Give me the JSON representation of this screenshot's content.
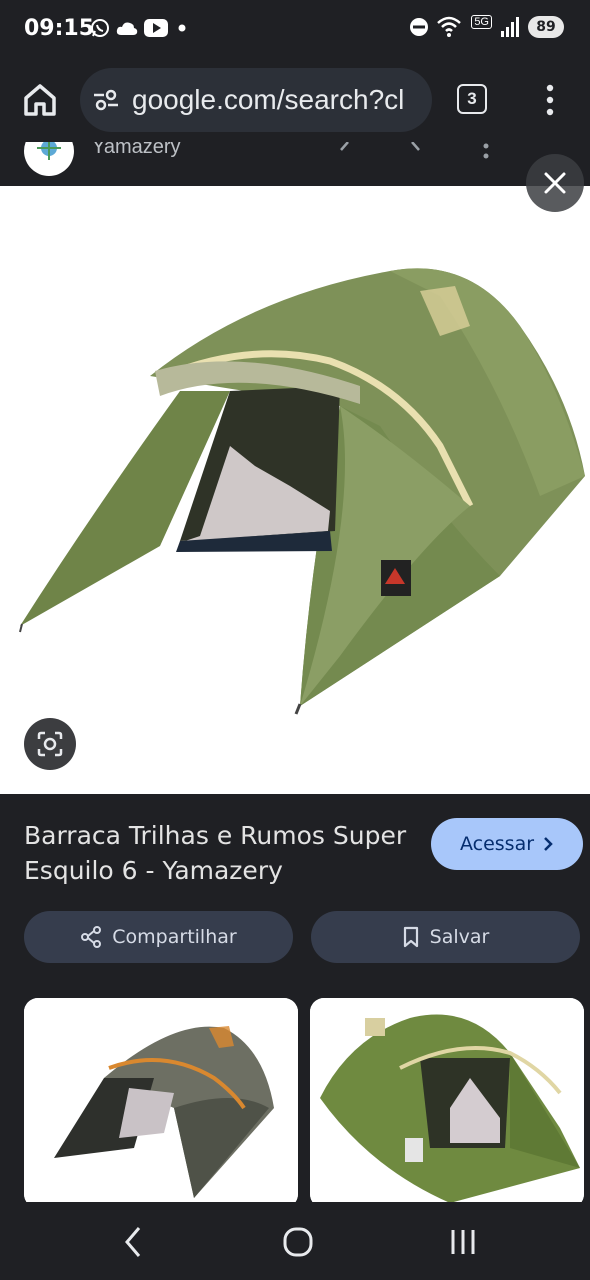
{
  "status_bar": {
    "time": "09:15",
    "left_icons": [
      "whatsapp-icon",
      "cloud-icon",
      "youtube-icon",
      "dot-icon"
    ],
    "right_icons": [
      "do-not-disturb-icon",
      "wifi-icon",
      "5g-icon",
      "signal-icon"
    ],
    "network_label": "5G",
    "battery": "89"
  },
  "browser": {
    "url": "google.com/search?cl",
    "tab_count": "3"
  },
  "source": {
    "name": "Yamazery"
  },
  "result": {
    "title": "Barraca Trilhas e Rumos Super Esquilo 6 - Yamazery",
    "visit_label": "Acessar",
    "share_label": "Compartilhar",
    "save_label": "Salvar"
  },
  "colors": {
    "background": "#1f2024",
    "accent_button": "#a8c7fa",
    "secondary_button": "#363d4d",
    "tent_green": "#7a8c54"
  }
}
